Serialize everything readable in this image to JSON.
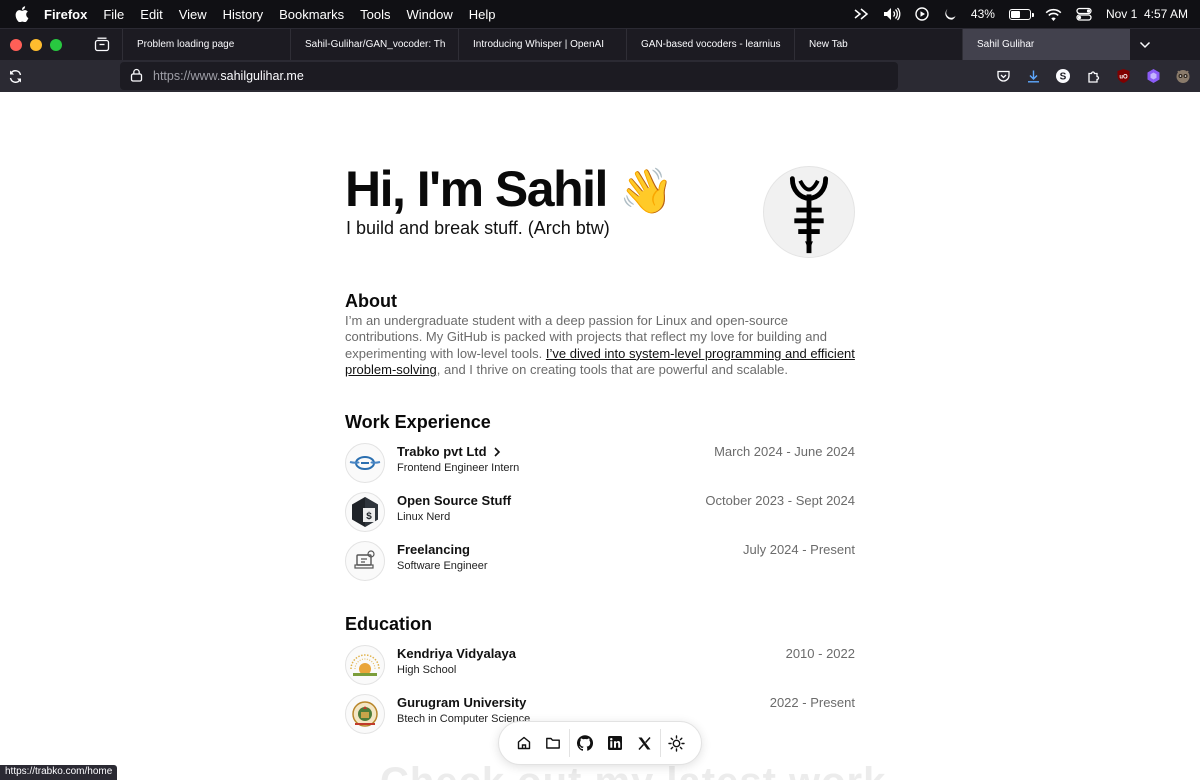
{
  "menubar": {
    "app_name": "Firefox",
    "items": [
      "File",
      "Edit",
      "View",
      "History",
      "Bookmarks",
      "Tools",
      "Window",
      "Help"
    ],
    "battery_percent_label": "43%",
    "battery_level": 0.43,
    "datetime": "Nov 1  4:57 AM",
    "status_icons": [
      "screen-share-icon",
      "volume-icon",
      "play-circle-icon",
      "moon-icon",
      "battery-icon",
      "wifi-icon",
      "control-center-icon"
    ]
  },
  "browser": {
    "tabs": [
      {
        "label": "Problem loading page",
        "active": false
      },
      {
        "label": "Sahil-Gulihar/GAN_vocoder: Th",
        "active": false
      },
      {
        "label": "Introducing Whisper | OpenAI",
        "active": false
      },
      {
        "label": "GAN-based vocoders - learnius",
        "active": false
      },
      {
        "label": "New Tab",
        "active": false
      },
      {
        "label": "Sahil Gulihar",
        "active": true
      }
    ],
    "url_prefix": "https://www.",
    "url_domain": "sahilgulihar.me",
    "status_url": "https://trabko.com/home"
  },
  "hero": {
    "title": "Hi, I'm Sahil",
    "wave": "👋",
    "subtitle": "I build and break stuff. (Arch btw)"
  },
  "about": {
    "heading": "About",
    "text_before": "I’m an undergraduate student with a deep passion for Linux and open-source contributions. My GitHub is packed with projects that reflect my love for building and experimenting with low-level tools. ",
    "link_text": "I’ve dived into system-level programming and efficient problem-solving",
    "text_after": ", and I thrive on creating tools that are powerful and scalable."
  },
  "work": {
    "heading": "Work Experience",
    "items": [
      {
        "title": "Trabko pvt Ltd",
        "subtitle": "Frontend Engineer Intern",
        "dates": "March 2024 - June 2024"
      },
      {
        "title": "Open Source Stuff",
        "subtitle": "Linux Nerd",
        "dates": "October 2023 - Sept 2024"
      },
      {
        "title": "Freelancing",
        "subtitle": "Software Engineer",
        "dates": "July 2024 - Present"
      }
    ]
  },
  "education": {
    "heading": "Education",
    "items": [
      {
        "title": "Kendriya Vidyalaya",
        "subtitle": "High School",
        "dates": "2010 - 2022"
      },
      {
        "title": "Gurugram University",
        "subtitle": "Btech in Computer Science",
        "dates": "2022 - Present"
      }
    ]
  },
  "dock": {
    "icons": [
      "home-icon",
      "folder-icon",
      "github-icon",
      "linkedin-icon",
      "x-icon",
      "sun-icon"
    ]
  },
  "ghost_heading": "Check out my latest work"
}
